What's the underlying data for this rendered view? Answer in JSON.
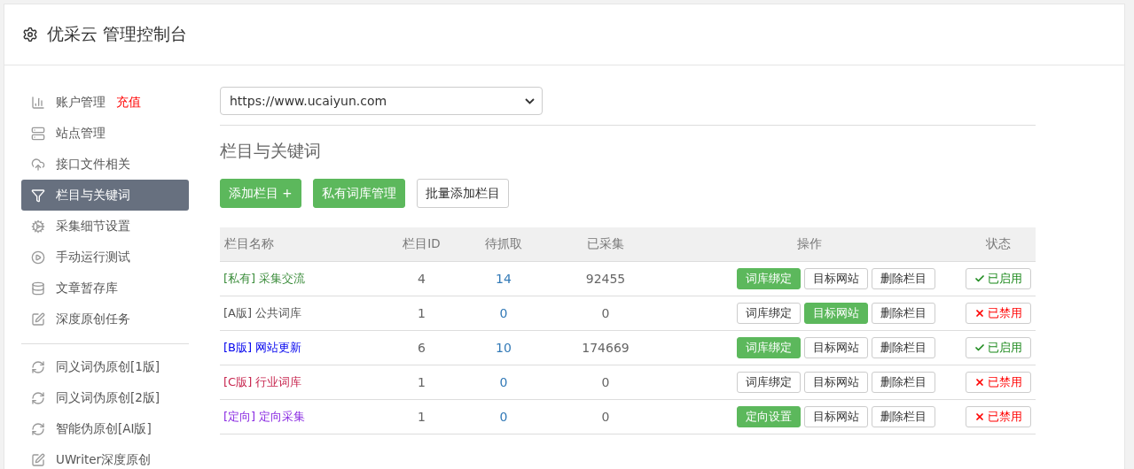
{
  "header": {
    "title": "优采云 管理控制台"
  },
  "sidebar": {
    "items": [
      {
        "label": "账户管理",
        "badge": "充值",
        "selected": false
      },
      {
        "label": "站点管理",
        "selected": false
      },
      {
        "label": "接口文件相关",
        "selected": false
      },
      {
        "label": "栏目与关键词",
        "selected": true
      },
      {
        "label": "采集细节设置",
        "selected": false
      },
      {
        "label": "手动运行测试",
        "selected": false
      },
      {
        "label": "文章暂存库",
        "selected": false
      },
      {
        "label": "深度原创任务",
        "selected": false
      }
    ],
    "tools": [
      {
        "label": "同义词伪原创[1版]"
      },
      {
        "label": "同义词伪原创[2版]"
      },
      {
        "label": "智能伪原创[AI版]"
      },
      {
        "label": "UWriter深度原创"
      }
    ]
  },
  "site_select": {
    "value": "https://www.ucaiyun.com"
  },
  "section_title": "栏目与关键词",
  "buttons": [
    {
      "label": "添加栏目 +",
      "primary": true
    },
    {
      "label": "私有词库管理",
      "primary": true
    },
    {
      "label": "批量添加栏目",
      "primary": false
    }
  ],
  "table": {
    "columns": [
      "栏目名称",
      "栏目ID",
      "待抓取",
      "已采集",
      "操作",
      "状态"
    ],
    "rows": [
      {
        "tag": "[私有]",
        "name": "采集交流",
        "color": "#3c8d3c",
        "id": "4",
        "pending": "14",
        "collected": "92455",
        "actions": [
          {
            "label": "词库绑定",
            "primary": true
          },
          {
            "label": "目标网站",
            "primary": false
          },
          {
            "label": "删除栏目",
            "primary": false
          }
        ],
        "status": "已启用",
        "enabled": true
      },
      {
        "tag": "[A版]",
        "name": "公共词库",
        "color": "#555555",
        "id": "1",
        "pending": "0",
        "collected": "0",
        "actions": [
          {
            "label": "词库绑定",
            "primary": false
          },
          {
            "label": "目标网站",
            "primary": true
          },
          {
            "label": "删除栏目",
            "primary": false
          }
        ],
        "status": "已禁用",
        "enabled": false
      },
      {
        "tag": "[B版]",
        "name": "网站更新",
        "color": "#0000ee",
        "id": "6",
        "pending": "10",
        "collected": "174669",
        "actions": [
          {
            "label": "词库绑定",
            "primary": true
          },
          {
            "label": "目标网站",
            "primary": false
          },
          {
            "label": "删除栏目",
            "primary": false
          }
        ],
        "status": "已启用",
        "enabled": true
      },
      {
        "tag": "[C版]",
        "name": "行业词库",
        "color": "#c7254e",
        "id": "1",
        "pending": "0",
        "collected": "0",
        "actions": [
          {
            "label": "词库绑定",
            "primary": false
          },
          {
            "label": "目标网站",
            "primary": false
          },
          {
            "label": "删除栏目",
            "primary": false
          }
        ],
        "status": "已禁用",
        "enabled": false
      },
      {
        "tag": "[定向]",
        "name": "定向采集",
        "color": "#8a2be2",
        "id": "1",
        "pending": "0",
        "collected": "0",
        "actions": [
          {
            "label": "定向设置",
            "primary": true
          },
          {
            "label": "目标网站",
            "primary": false
          },
          {
            "label": "删除栏目",
            "primary": false
          }
        ],
        "status": "已禁用",
        "enabled": false
      }
    ]
  }
}
